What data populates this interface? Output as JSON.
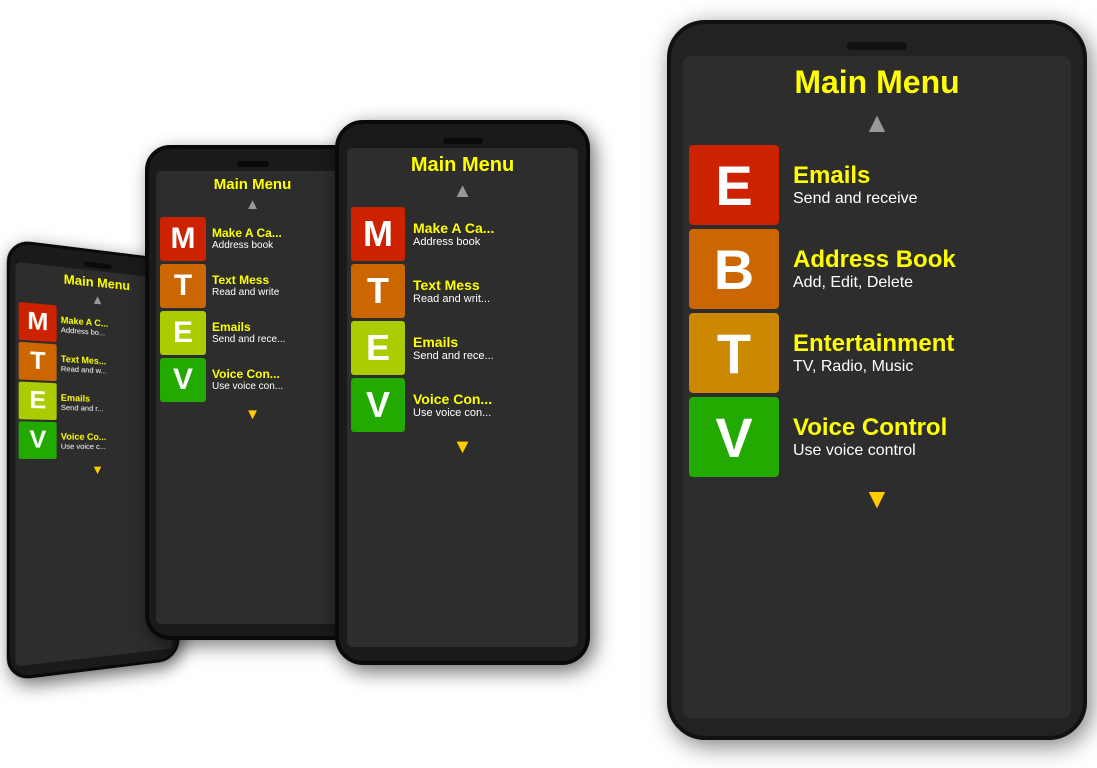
{
  "colors": {
    "bg": "white",
    "red": "#cc2200",
    "orange_text": "#cc6600",
    "gold": "#cc8800",
    "green": "#22aa00",
    "yellow": "#ffff00",
    "arrow_gray": "#999999",
    "arrow_yellow": "#ffcc00"
  },
  "menu": {
    "title": "Main Menu",
    "items": [
      {
        "letter": "E",
        "title": "Emails",
        "sub": "Send and receive",
        "color": "#cc2200"
      },
      {
        "letter": "B",
        "title": "Address Book",
        "sub": "Add, Edit, Delete",
        "color": "#cc6600"
      },
      {
        "letter": "T",
        "title": "Entertainment",
        "sub": "TV, Radio, Music",
        "color": "#cc8800"
      },
      {
        "letter": "V",
        "title": "Voice Control",
        "sub": "Use voice control",
        "color": "#22aa00"
      }
    ],
    "items_medium": [
      {
        "letter": "M",
        "title": "Make A Ca...",
        "sub": "Address book",
        "color": "#cc2200"
      },
      {
        "letter": "T",
        "title": "Text Mess...",
        "sub": "Read and writ...",
        "color": "#cc6600"
      },
      {
        "letter": "E",
        "title": "Emails",
        "sub": "Send and rece...",
        "color": "#aacc00"
      },
      {
        "letter": "V",
        "title": "Voice Con...",
        "sub": "Use voice con...",
        "color": "#22aa00"
      }
    ],
    "items_small": [
      {
        "letter": "M",
        "title": "Make A C...",
        "sub": "Address bo...",
        "color": "#cc2200"
      },
      {
        "letter": "T",
        "title": "Text Mes...",
        "sub": "Read and w...",
        "color": "#cc6600"
      },
      {
        "letter": "E",
        "title": "Emails",
        "sub": "Send and r...",
        "color": "#aacc00"
      },
      {
        "letter": "V",
        "title": "Voice Co...",
        "sub": "Use voice c...",
        "color": "#22aa00"
      }
    ]
  }
}
